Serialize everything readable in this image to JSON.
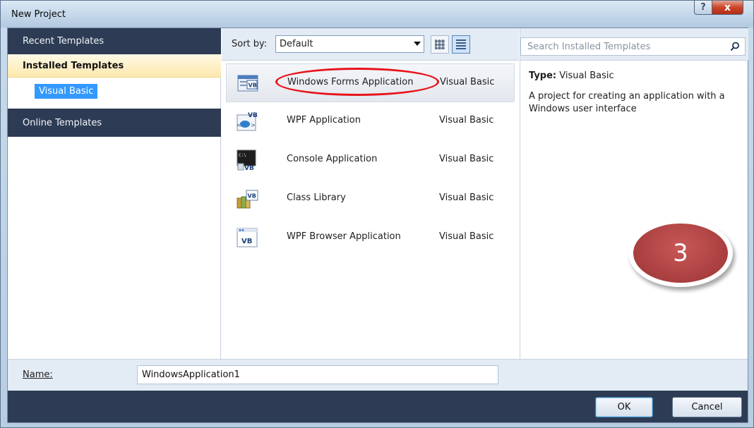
{
  "window": {
    "title": "New Project",
    "help_glyph": "?",
    "close_glyph": "x"
  },
  "nav": {
    "recent": "Recent Templates",
    "installed": "Installed Templates",
    "selected_language": "Visual Basic",
    "online": "Online Templates"
  },
  "toolbar": {
    "sort_label": "Sort by:",
    "sort_value": "Default"
  },
  "templates": [
    {
      "name": "Windows Forms Application",
      "language": "Visual Basic",
      "icon": "windows-forms-icon"
    },
    {
      "name": "WPF Application",
      "language": "Visual Basic",
      "icon": "wpf-app-icon"
    },
    {
      "name": "Console Application",
      "language": "Visual Basic",
      "icon": "console-app-icon"
    },
    {
      "name": "Class Library",
      "language": "Visual Basic",
      "icon": "class-library-icon"
    },
    {
      "name": "WPF Browser Application",
      "language": "Visual Basic",
      "icon": "wpf-browser-icon"
    }
  ],
  "search": {
    "placeholder": "Search Installed Templates"
  },
  "details": {
    "type_key": "Type:",
    "type_value": "Visual Basic",
    "description": "A project for creating an application with a Windows user interface"
  },
  "annotation": {
    "step": "3"
  },
  "name_field": {
    "label": "Name:",
    "value": "WindowsApplication1"
  },
  "buttons": {
    "ok": "OK",
    "cancel": "Cancel"
  },
  "colors": {
    "nav_dark": "#2d3c54",
    "selection": "#3399ff",
    "annotation_red": "#e8141c",
    "badge": "#a93e3e"
  }
}
